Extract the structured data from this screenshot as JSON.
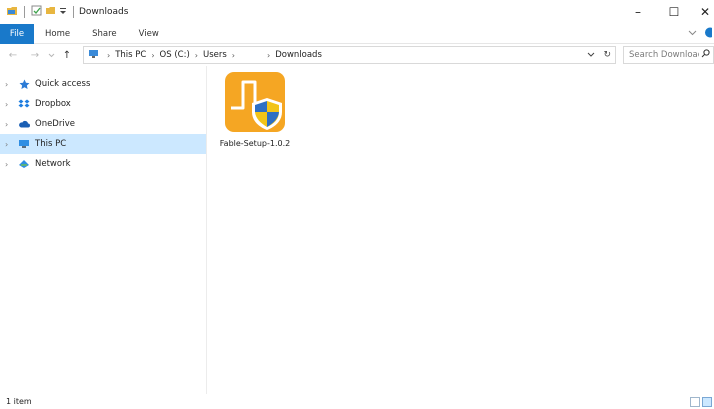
{
  "window": {
    "title": "Downloads",
    "minimize_glyph": "–",
    "maximize_glyph": "☐",
    "close_glyph": "✕"
  },
  "ribbon": {
    "tabs": [
      {
        "label": "File"
      },
      {
        "label": "Home"
      },
      {
        "label": "Share"
      },
      {
        "label": "View"
      }
    ]
  },
  "address": {
    "back_glyph": "←",
    "forward_glyph": "→",
    "up_glyph": "↑",
    "crumbs": [
      "This PC",
      "OS (C:)",
      "Users",
      "",
      "Downloads"
    ],
    "refresh_glyph": "↻"
  },
  "search": {
    "placeholder": "Search Downloads"
  },
  "navigation": {
    "items": [
      {
        "label": "Quick access",
        "icon": "star-icon",
        "selected": false
      },
      {
        "label": "Dropbox",
        "icon": "dropbox-icon",
        "selected": false
      },
      {
        "label": "OneDrive",
        "icon": "cloud-icon",
        "selected": false
      },
      {
        "label": "This PC",
        "icon": "computer-icon",
        "selected": true
      },
      {
        "label": "Network",
        "icon": "network-icon",
        "selected": false
      }
    ]
  },
  "files": [
    {
      "name": "Fable-Setup-1.0.2",
      "icon": "installer-shield-icon"
    }
  ],
  "status": {
    "item_count": "1 item"
  },
  "colors": {
    "accent": "#1979ca",
    "selected": "#cce8ff",
    "app_icon_orange": "#f5a623"
  }
}
